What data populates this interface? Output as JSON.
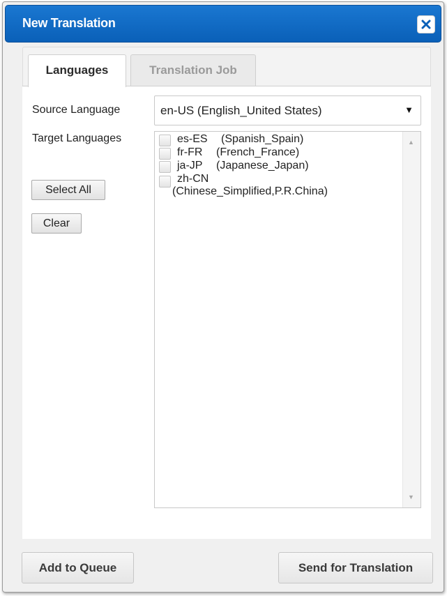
{
  "dialog": {
    "title": "New Translation",
    "close_icon": "close-icon"
  },
  "tabs": [
    {
      "label": "Languages",
      "active": true
    },
    {
      "label": "Translation Job",
      "active": false
    }
  ],
  "source_language": {
    "label": "Source Language",
    "value": "en-US  (English_United States)",
    "arrow_icon": "dropdown-arrow-icon"
  },
  "target_languages": {
    "label": "Target Languages",
    "select_all_label": "Select All",
    "clear_label": "Clear",
    "items": [
      {
        "code": "es-ES",
        "name": "(Spanish_Spain)",
        "checked": false
      },
      {
        "code": "fr-FR",
        "name": "(French_France)",
        "checked": false
      },
      {
        "code": "ja-JP",
        "name": "(Japanese_Japan)",
        "checked": false
      },
      {
        "code": "zh-CN",
        "name": "(Chinese_Simplified,P.R.China)",
        "checked": false
      }
    ]
  },
  "footer": {
    "add_to_queue_label": "Add to Queue",
    "send_label": "Send for Translation"
  },
  "colors": {
    "titlebar": "#0a60b8",
    "title_text": "#ffffff",
    "inactive_tab_text": "#9a9a9a"
  }
}
